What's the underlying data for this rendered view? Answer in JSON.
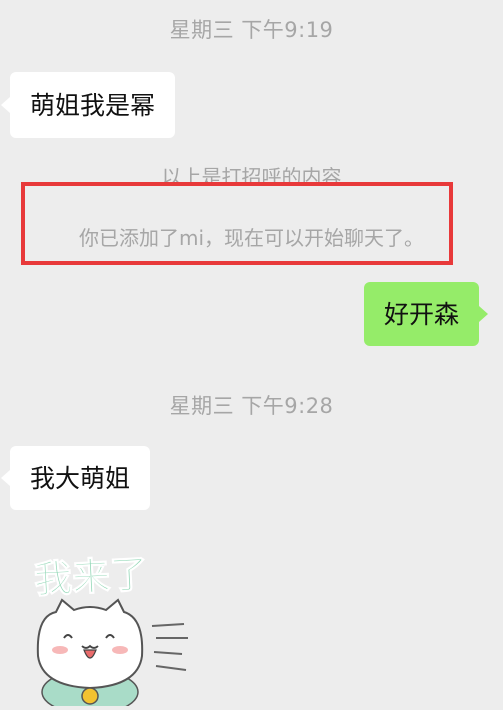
{
  "messages": {
    "time_1": "星期三 下午9:19",
    "msg_1": "萌姐我是幂",
    "sys_hint": "以上是打招呼的内容",
    "sys_added": "你已添加了mi，现在可以开始聊天了。",
    "msg_2": "好开森",
    "time_2": "星期三 下午9:28",
    "msg_3": "我大萌姐",
    "sticker_text": "我来了"
  },
  "colors": {
    "background": "#ededed",
    "incoming_bubble": "#ffffff",
    "outgoing_bubble": "#95ec69",
    "highlight_border": "#e8393a",
    "timestamp_text": "#a6a6a6",
    "sticker_text": "#8fd6b4"
  }
}
